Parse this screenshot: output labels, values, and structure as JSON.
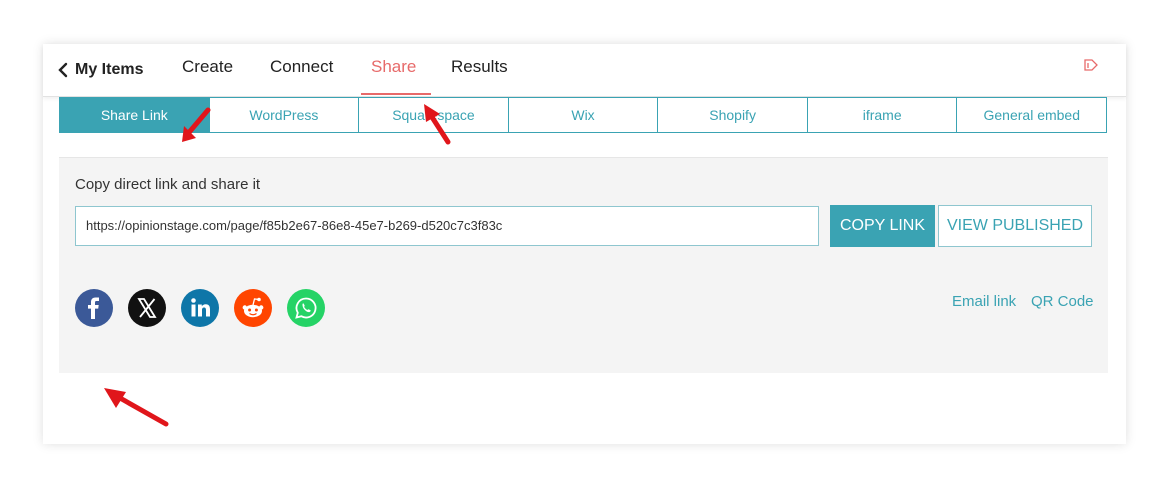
{
  "nav": {
    "back_label": "My Items",
    "items": [
      "Create",
      "Connect",
      "Share",
      "Results"
    ],
    "active": "Share"
  },
  "tabs": [
    "Share Link",
    "WordPress",
    "Squarespace",
    "Wix",
    "Shopify",
    "iframe",
    "General embed"
  ],
  "active_tab": "Share Link",
  "share_link": {
    "title": "Copy direct link and share it",
    "url": "https://opinionstage.com/page/f85b2e67-86e8-45e7-b269-d520c7c3f83c",
    "copy_label": "COPY LINK",
    "view_label": "VIEW PUBLISHED",
    "email_label": "Email link",
    "qr_label": "QR Code"
  },
  "social_icons": [
    "facebook-icon",
    "x-icon",
    "linkedin-icon",
    "reddit-icon",
    "whatsapp-icon"
  ],
  "colors": {
    "accent": "#3aa3b3",
    "active_nav": "#e76a6a",
    "annotation_arrow": "#e0161b"
  }
}
